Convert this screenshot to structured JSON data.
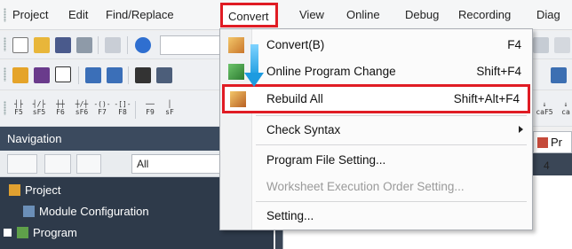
{
  "menubar": {
    "items": [
      "Project",
      "Edit",
      "Find/Replace",
      "Convert",
      "View",
      "Online",
      "Debug",
      "Recording",
      "Diag"
    ]
  },
  "toolbar": {
    "fkeys": [
      "F5",
      "sF5",
      "F6",
      "sF6",
      "F7",
      "F8",
      "F9",
      "sF"
    ],
    "extra_labels": [
      "caF5",
      "ca"
    ]
  },
  "navigation": {
    "title": "Navigation",
    "filter_value": "All",
    "tree": [
      {
        "label": "Project"
      },
      {
        "label": "Module Configuration"
      },
      {
        "label": "Program"
      }
    ]
  },
  "editor": {
    "tab_label": "Pr",
    "column_header": "4"
  },
  "convert_menu": {
    "items": [
      {
        "label": "Convert(B)",
        "shortcut": "F4"
      },
      {
        "label": "Online Program Change",
        "shortcut": "Shift+F4"
      },
      {
        "label": "Rebuild All",
        "shortcut": "Shift+Alt+F4"
      },
      {
        "label": "Check Syntax",
        "shortcut": ""
      },
      {
        "label": "Program File Setting...",
        "shortcut": ""
      },
      {
        "label": "Worksheet Execution Order Setting...",
        "shortcut": ""
      },
      {
        "label": "Setting...",
        "shortcut": ""
      }
    ]
  },
  "colors": {
    "highlight": "#e01c24",
    "arrow": "#1d9be0",
    "nav_background": "#2e3a4a"
  }
}
